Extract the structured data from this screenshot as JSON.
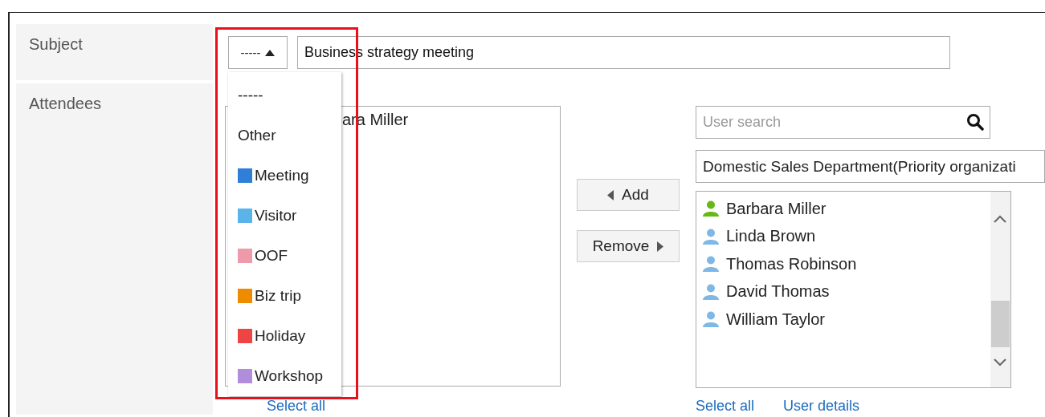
{
  "subject": {
    "label": "Subject",
    "category_select": {
      "value": "-----",
      "expanded": true
    },
    "title_value": "Business strategy meeting",
    "menu": [
      {
        "kind": "plain",
        "label": "-----"
      },
      {
        "kind": "plain",
        "label": "Other"
      },
      {
        "kind": "swatch",
        "label": "Meeting",
        "color": "#2f7fd8"
      },
      {
        "kind": "swatch",
        "label": "Visitor",
        "color": "#5ab4ea"
      },
      {
        "kind": "swatch",
        "label": "OOF",
        "color": "#ee9aaa"
      },
      {
        "kind": "swatch",
        "label": "Biz trip",
        "color": "#ee8c00"
      },
      {
        "kind": "swatch",
        "label": "Holiday",
        "color": "#ee4444"
      },
      {
        "kind": "swatch",
        "label": "Workshop",
        "color": "#b08edc"
      }
    ]
  },
  "attendees": {
    "label": "Attendees",
    "selected_list": [
      "ara Miller"
    ],
    "select_all": "Select all",
    "add_button": "Add",
    "remove_button": "Remove",
    "search": {
      "placeholder": "User search"
    },
    "organization": "Domestic Sales Department(Priority organizati",
    "candidates": [
      {
        "name": "Barbara Miller",
        "color": "#66b814"
      },
      {
        "name": "Linda Brown",
        "color": "#7fb8e6"
      },
      {
        "name": "Thomas Robinson",
        "color": "#7fb8e6"
      },
      {
        "name": "David Thomas",
        "color": "#7fb8e6"
      },
      {
        "name": "William Taylor",
        "color": "#7fb8e6"
      }
    ],
    "links": [
      "Select all",
      "User details"
    ]
  }
}
